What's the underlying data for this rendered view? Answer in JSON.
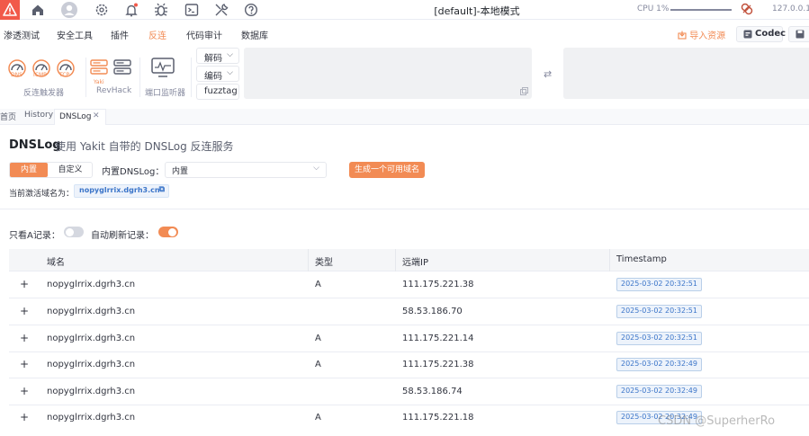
{
  "topbar": {
    "title": "[default]-本地模式",
    "cpu_label": "CPU 1%",
    "host": "127.0.0.1"
  },
  "menu": {
    "items": [
      "渗透测试",
      "安全工具",
      "插件",
      "反连",
      "代码审计",
      "数据库"
    ],
    "active": "反连",
    "import_label": "导入资源",
    "codec_label": "Codec"
  },
  "ribbon": {
    "reverse_group_label": "反连触发器",
    "reverse_items": [
      "DNS",
      "ICMP",
      "TCP"
    ],
    "revhack_label": "RevHack",
    "yaki_label": "Yaki",
    "port_monitor_label": "端口监听器",
    "decode_label": "解码",
    "encode_label": "编码",
    "fuzztag_label": "fuzztag"
  },
  "tabs": {
    "home": "首页",
    "history": "History",
    "dnslog": "DNSLog"
  },
  "panel": {
    "title": "DNSLog",
    "subtitle": "使用 Yakit 自带的 DNSLog 反连服务",
    "seg_builtin": "内置",
    "seg_custom": "自定义",
    "builtin_label": "内置DNSLog：",
    "builtin_value": "内置",
    "generate_button": "生成一个可用域名",
    "active_label": "当前激活域名为：",
    "active_domain": "nopyglrrix.dgrh3.cn",
    "only_a_label": "只看A记录：",
    "auto_refresh_label": "自动刷新记录："
  },
  "toggles": {
    "only_a": false,
    "auto_refresh": true
  },
  "table": {
    "headers": [
      "域名",
      "类型",
      "远端IP",
      "Timestamp"
    ],
    "rows": [
      {
        "domain": "nopyglrrix.dgrh3.cn",
        "type": "A",
        "ip": "111.175.221.38",
        "ts": "2025-03-02 20:32:51"
      },
      {
        "domain": "nopyglrrix.dgrh3.cn",
        "type": "",
        "ip": "58.53.186.70",
        "ts": "2025-03-02 20:32:51"
      },
      {
        "domain": "nopyglrrix.dgrh3.cn",
        "type": "A",
        "ip": "111.175.221.14",
        "ts": "2025-03-02 20:32:51"
      },
      {
        "domain": "nopyglrrix.dgrh3.cn",
        "type": "A",
        "ip": "111.175.221.38",
        "ts": "2025-03-02 20:32:49"
      },
      {
        "domain": "nopyglrrix.dgrh3.cn",
        "type": "",
        "ip": "58.53.186.74",
        "ts": "2025-03-02 20:32:49"
      },
      {
        "domain": "nopyglrrix.dgrh3.cn",
        "type": "A",
        "ip": "111.175.221.18",
        "ts": "2025-03-02 20:32:49"
      }
    ]
  },
  "watermark": "CSDN @SuperherRo",
  "colors": {
    "accent": "#f28b54",
    "logo_red": "#f1594a",
    "tag_blue": "#3b75c9"
  }
}
